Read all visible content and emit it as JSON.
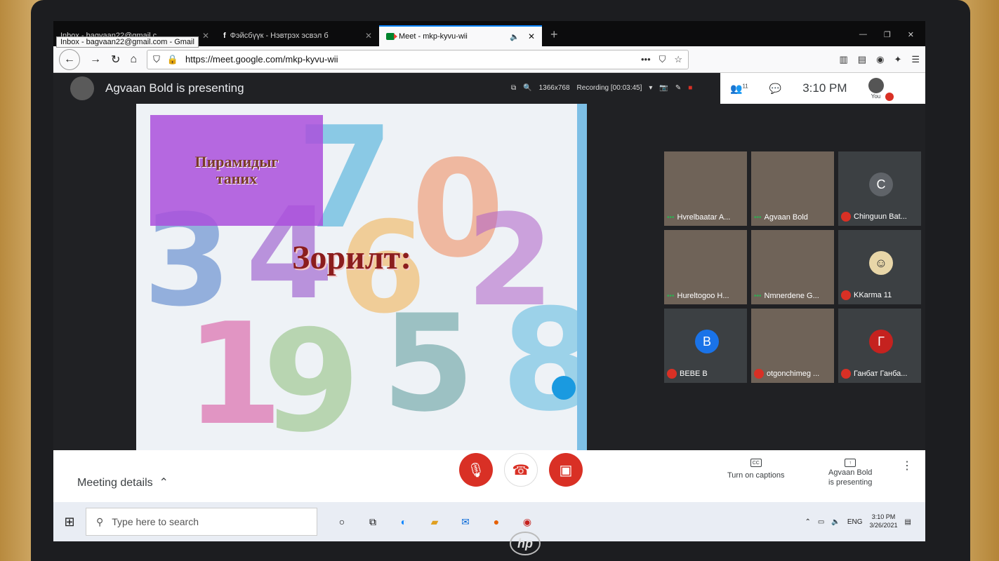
{
  "browser": {
    "tabs": [
      {
        "label": "Inbox - bagvaan22@gmail.c",
        "active": false
      },
      {
        "label": "Фэйсбүүк - Нэвтрэх эсвэл б",
        "active": false
      },
      {
        "label": "Meet - mkp-kyvu-wii",
        "active": true
      }
    ],
    "tooltip": "Inbox - bagvaan22@gmail.com - Gmail",
    "url": "https://meet.google.com/mkp-kyvu-wii",
    "new_tab": "+"
  },
  "meet": {
    "presenting_title": "Agvaan Bold is presenting",
    "recording": {
      "resolution": "1366x768",
      "status": "Recording [00:03:45]"
    },
    "people_count": "11",
    "clock": "3:10 PM",
    "you_label": "You"
  },
  "slide": {
    "box_title_line1": "Пирамидыг",
    "box_title_line2": "таних",
    "heading": "Зорилт:",
    "digits": [
      "7",
      "0",
      "6",
      "3",
      "4",
      "2",
      "1",
      "9",
      "5",
      "8"
    ]
  },
  "participants": [
    {
      "name": "Hvrelbaatar A...",
      "kind": "video",
      "status": "speaking"
    },
    {
      "name": "Agvaan Bold",
      "kind": "video",
      "status": "speaking"
    },
    {
      "name": "Chinguun Bat...",
      "kind": "letter",
      "letter": "C",
      "color": "#5f6368",
      "status": "muted"
    },
    {
      "name": "Hureltogoo H...",
      "kind": "video",
      "status": "speaking"
    },
    {
      "name": "Nmnerdene G...",
      "kind": "video",
      "status": "speaking"
    },
    {
      "name": "KKarma 11",
      "kind": "avatar",
      "status": "muted"
    },
    {
      "name": "BEBE B",
      "kind": "letter",
      "letter": "B",
      "color": "#1a73e8",
      "status": "muted"
    },
    {
      "name": "otgonchimeg ...",
      "kind": "video",
      "status": "muted"
    },
    {
      "name": "Ганбат Ганба...",
      "kind": "letter",
      "letter": "Г",
      "color": "#c5221f",
      "status": "muted"
    }
  ],
  "bottom": {
    "meeting_details": "Meeting details",
    "captions_label": "Turn on captions",
    "present_label_line1": "Agvaan Bold",
    "present_label_line2": "is presenting"
  },
  "taskbar": {
    "search_placeholder": "Type here to search",
    "lang": "ENG",
    "time": "3:10 PM",
    "date": "3/26/2021"
  },
  "logo": "hp",
  "colors": {
    "accent_red": "#d93025",
    "tab_accent": "#0a84ff",
    "slide_heading": "#8b1d1d",
    "box_purple": "#aa50dc"
  }
}
